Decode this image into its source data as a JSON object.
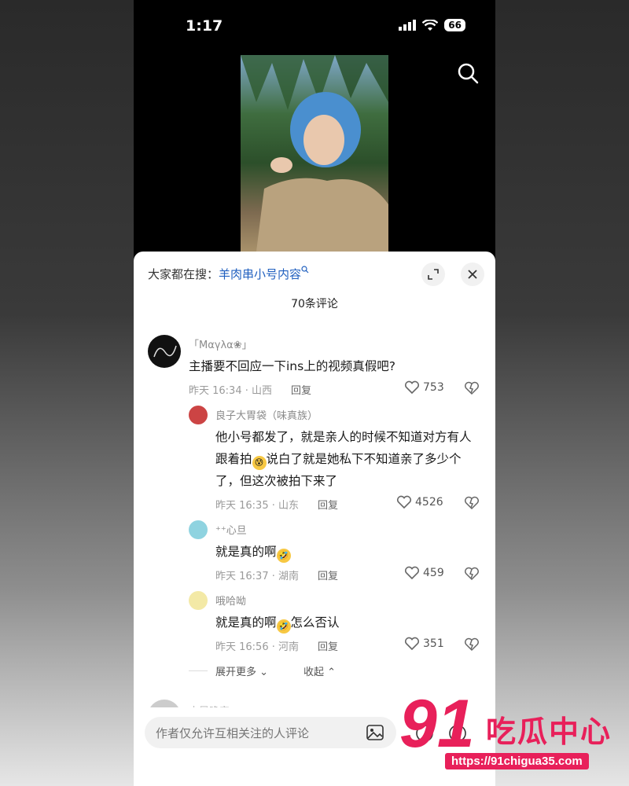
{
  "status_bar": {
    "time": "1:17",
    "battery": "66"
  },
  "panel": {
    "trending_prefix": "大家都在搜：",
    "trending_keyword": "羊肉串小号内容",
    "comment_count": "70条评论",
    "comments": [
      {
        "username": "「Μαγλα❀」",
        "text": "主播要不回应一下ins上的视频真假吧?",
        "meta": "昨天 16:34 · 山西",
        "reply_label": "回复",
        "likes": "753"
      }
    ],
    "replies": [
      {
        "username": "良子大胃袋（味真族）",
        "text_part1": "他小号都发了，就是亲人的时候不知道对方有人跟着拍",
        "emoji": "😰",
        "text_part2": "说白了就是她私下不知道亲了多少个了，但这次被拍下来了",
        "meta": "昨天 16:35 · 山东",
        "reply_label": "回复",
        "likes": "4526"
      },
      {
        "username": "⁺⁺心旦",
        "text_part1": "就是真的啊",
        "emoji": "🤣",
        "meta": "昨天 16:37 · 湖南",
        "reply_label": "回复",
        "likes": "459"
      },
      {
        "username": "哦哈呦",
        "text_part1": "就是真的啊",
        "emoji": "🤣",
        "text_part2": "怎么否认",
        "meta": "昨天 16:56 · 河南",
        "reply_label": "回复",
        "likes": "351"
      }
    ],
    "expand_more": "展开更多",
    "collapse": "收起",
    "next_username_partial": "小局晚安",
    "input_placeholder": "作者仅允许互相关注的人评论"
  },
  "watermark": {
    "number": "91",
    "text": "吃瓜中心",
    "url": "https://91chigua35.com"
  }
}
